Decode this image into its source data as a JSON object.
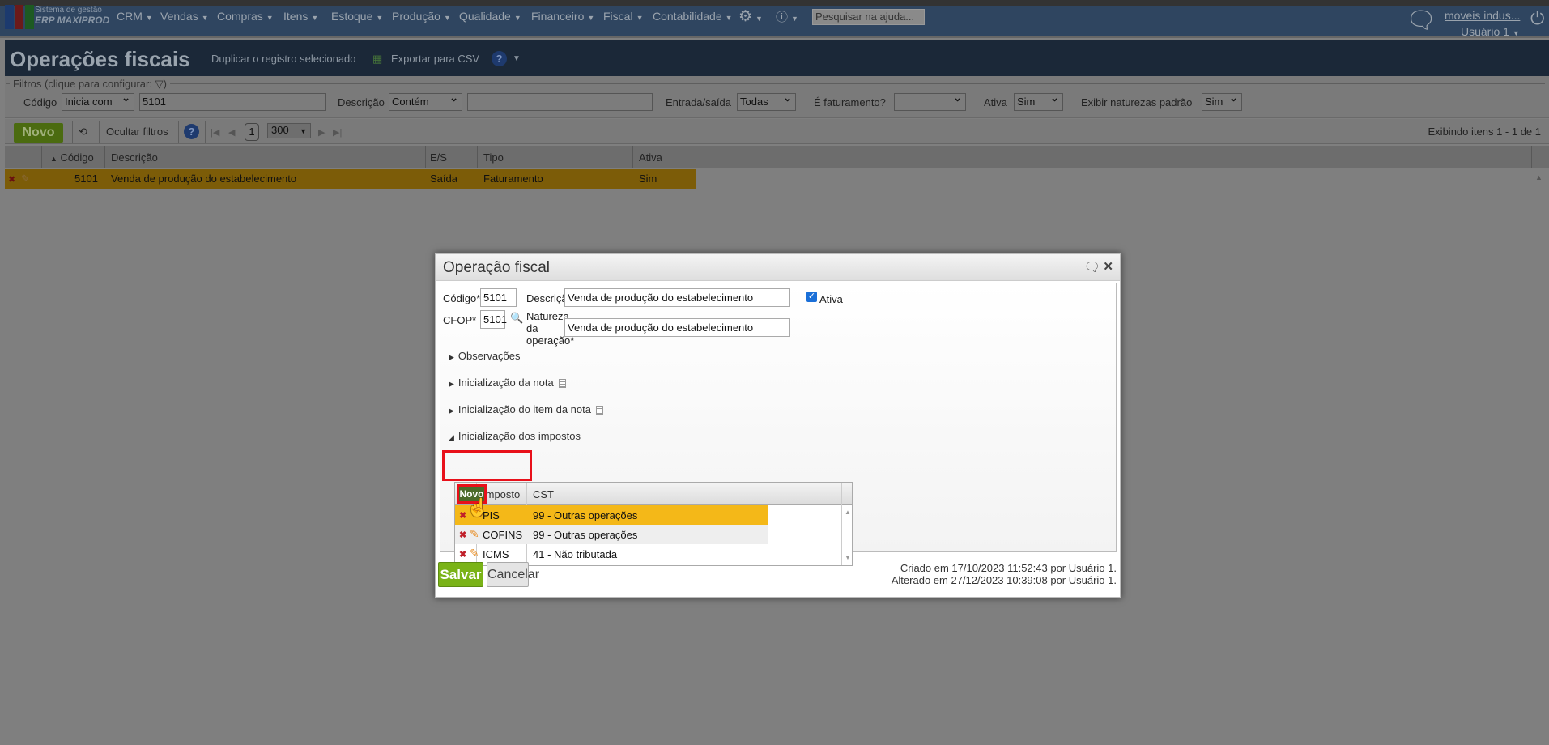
{
  "nav": {
    "logo_line1": "Sistema de gestão",
    "logo_line2": "ERP MAXIPROD",
    "menu": [
      "CRM",
      "Vendas",
      "Compras",
      "Itens",
      "Estoque",
      "Produção",
      "Qualidade",
      "Financeiro",
      "Fiscal",
      "Contabilidade"
    ],
    "help_search_placeholder": "Pesquisar na ajuda...",
    "company": "moveis indus...",
    "user": "Usuário 1"
  },
  "page": {
    "title": "Operações fiscais",
    "duplicate": "Duplicar o registro selecionado",
    "export_csv": "Exportar para CSV"
  },
  "filters": {
    "legend": "Filtros (clique para configurar:",
    "codigo_label": "Código",
    "codigo_op": "Inicia com",
    "codigo_value": "5101",
    "descricao_label": "Descrição",
    "descricao_op": "Contém",
    "descricao_value": "",
    "es_label": "Entrada/saída",
    "es_value": "Todas",
    "fat_label": "É faturamento?",
    "fat_value": "",
    "ativa_label": "Ativa",
    "ativa_value": "Sim",
    "naturezas_label": "Exibir naturezas padrão",
    "naturezas_value": "Sim"
  },
  "toolbar": {
    "novo": "Novo",
    "hide_filters": "Ocultar filtros",
    "page": "1",
    "page_size": "300",
    "showing": "Exibindo itens 1 - 1 de 1"
  },
  "grid": {
    "columns": [
      "Código",
      "Descrição",
      "E/S",
      "Tipo",
      "Ativa"
    ],
    "rows": [
      {
        "codigo": "5101",
        "descricao": "Venda de produção do estabelecimento",
        "es": "Saída",
        "tipo": "Faturamento",
        "ativa": "Sim"
      }
    ]
  },
  "modal": {
    "title": "Operação fiscal",
    "codigo_label": "Código*",
    "codigo_value": "5101",
    "cfop_label": "CFOP*",
    "cfop_value": "5101",
    "descricao_label": "Descrição*",
    "descricao_value": "Venda de produção do estabelecimento",
    "natureza_label_1": "Natureza",
    "natureza_label_2": "da",
    "natureza_label_3": "operação*",
    "natureza_value": "Venda de produção do estabelecimento",
    "ativa_label": "Ativa",
    "ativa_checked": true,
    "sections": [
      "Observações",
      "Inicialização da nota",
      "Inicialização do item da nota",
      "Inicialização dos impostos"
    ],
    "tax_table": {
      "novo": "Novo",
      "columns": [
        "Imposto",
        "CST"
      ],
      "rows": [
        {
          "imposto": "PIS",
          "cst": "99 - Outras operações"
        },
        {
          "imposto": "COFINS",
          "cst": "99 - Outras operações"
        },
        {
          "imposto": "ICMS",
          "cst": "41 - Não tributada"
        }
      ]
    },
    "save": "Salvar",
    "cancel": "Cancelar",
    "created": "Criado em 17/10/2023 11:52:43 por Usuário 1.",
    "modified": "Alterado em 27/12/2023 10:39:08 por Usuário 1."
  }
}
